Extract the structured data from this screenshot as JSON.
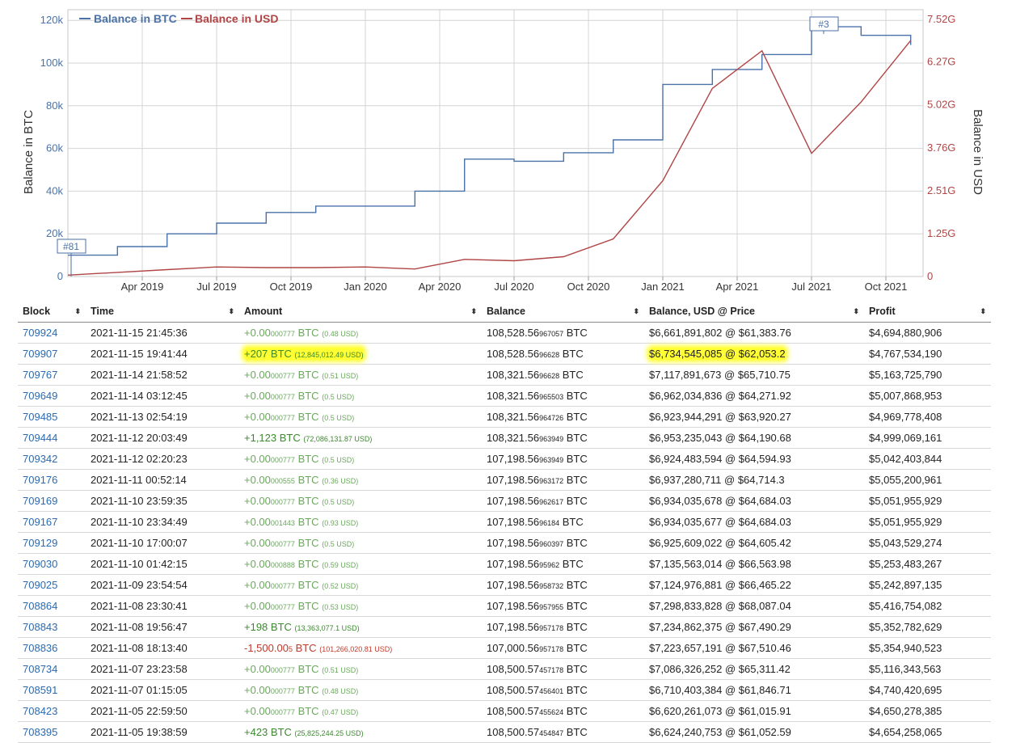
{
  "chart": {
    "legend": [
      {
        "label": "Balance in BTC",
        "color": "#4a72a8"
      },
      {
        "label": "Balance in USD",
        "color": "#b04545"
      }
    ],
    "y_left_label": "Balance in BTC",
    "y_right_label": "Balance in USD",
    "y_left_ticks": [
      "0",
      "20k",
      "40k",
      "60k",
      "80k",
      "100k",
      "120k"
    ],
    "y_right_ticks": [
      "0",
      "1.25G",
      "2.51G",
      "3.76G",
      "5.02G",
      "6.27G",
      "7.52G"
    ],
    "x_ticks": [
      "Apr 2019",
      "Jul 2019",
      "Oct 2019",
      "Jan 2020",
      "Apr 2020",
      "Jul 2020",
      "Oct 2020",
      "Jan 2021",
      "Apr 2021",
      "Jul 2021",
      "Oct 2021"
    ],
    "marker_start": "#81",
    "marker_peak": "#3"
  },
  "chart_data": {
    "type": "line",
    "x": [
      "2019-01",
      "2019-03",
      "2019-05",
      "2019-07",
      "2019-09",
      "2019-11",
      "2020-01",
      "2020-03",
      "2020-05",
      "2020-07",
      "2020-09",
      "2020-11",
      "2021-01",
      "2021-03",
      "2021-05",
      "2021-07",
      "2021-09",
      "2021-11"
    ],
    "series": [
      {
        "name": "Balance in BTC",
        "axis": "left",
        "color": "#4a72a8",
        "values": [
          10000,
          14000,
          20000,
          25000,
          30000,
          33000,
          33000,
          40000,
          55000,
          54000,
          58000,
          64000,
          90000,
          97000,
          104000,
          117000,
          113000,
          108500
        ]
      },
      {
        "name": "Balance in USD",
        "axis": "right",
        "color": "#b04545",
        "values": [
          40000000,
          120000000,
          200000000,
          280000000,
          260000000,
          260000000,
          280000000,
          220000000,
          500000000,
          460000000,
          580000000,
          1100000000,
          2800000000,
          5500000000,
          6600000000,
          3600000000,
          5100000000,
          6900000000
        ]
      }
    ],
    "ylim_left": [
      0,
      125000
    ],
    "ylim_right": [
      0,
      7800000000
    ],
    "legend_position": "top-left"
  },
  "table": {
    "headers": [
      "Block",
      "Time",
      "Amount",
      "Balance",
      "Balance, USD @ Price",
      "Profit"
    ],
    "rows": [
      {
        "block": "709924",
        "time": "2021-11-15 21:45:36",
        "amt_main": "+0.00",
        "amt_small": "000777",
        "amt_unit": " BTC",
        "amt_usd": "(0.48 USD)",
        "amt_type": "zero",
        "bal_main": "108,528.56",
        "bal_small": "967057",
        "bal_unit": " BTC",
        "usd": "$6,661,891,802 @ $61,383.76",
        "profit": "$4,694,880,906",
        "hl": false
      },
      {
        "block": "709907",
        "time": "2021-11-15 19:41:44",
        "amt_main": "+207",
        "amt_small": "",
        "amt_unit": " BTC",
        "amt_usd": "(12,845,012.49 USD)",
        "amt_type": "pos",
        "bal_main": "108,528.56",
        "bal_small": "96628",
        "bal_unit": " BTC",
        "usd": "$6,734,545,085 @ $62,053.2",
        "profit": "$4,767,534,190",
        "hl": true
      },
      {
        "block": "709767",
        "time": "2021-11-14 21:58:52",
        "amt_main": "+0.00",
        "amt_small": "000777",
        "amt_unit": " BTC",
        "amt_usd": "(0.51 USD)",
        "amt_type": "zero",
        "bal_main": "108,321.56",
        "bal_small": "96628",
        "bal_unit": " BTC",
        "usd": "$7,117,891,673 @ $65,710.75",
        "profit": "$5,163,725,790",
        "hl": false
      },
      {
        "block": "709649",
        "time": "2021-11-14 03:12:45",
        "amt_main": "+0.00",
        "amt_small": "000777",
        "amt_unit": " BTC",
        "amt_usd": "(0.5 USD)",
        "amt_type": "zero",
        "bal_main": "108,321.56",
        "bal_small": "965503",
        "bal_unit": " BTC",
        "usd": "$6,962,034,836 @ $64,271.92",
        "profit": "$5,007,868,953",
        "hl": false
      },
      {
        "block": "709485",
        "time": "2021-11-13 02:54:19",
        "amt_main": "+0.00",
        "amt_small": "000777",
        "amt_unit": " BTC",
        "amt_usd": "(0.5 USD)",
        "amt_type": "zero",
        "bal_main": "108,321.56",
        "bal_small": "964726",
        "bal_unit": " BTC",
        "usd": "$6,923,944,291 @ $63,920.27",
        "profit": "$4,969,778,408",
        "hl": false
      },
      {
        "block": "709444",
        "time": "2021-11-12 20:03:49",
        "amt_main": "+1,123",
        "amt_small": "",
        "amt_unit": " BTC",
        "amt_usd": "(72,086,131.87 USD)",
        "amt_type": "pos",
        "bal_main": "108,321.56",
        "bal_small": "963949",
        "bal_unit": " BTC",
        "usd": "$6,953,235,043 @ $64,190.68",
        "profit": "$4,999,069,161",
        "hl": false
      },
      {
        "block": "709342",
        "time": "2021-11-12 02:20:23",
        "amt_main": "+0.00",
        "amt_small": "000777",
        "amt_unit": " BTC",
        "amt_usd": "(0.5 USD)",
        "amt_type": "zero",
        "bal_main": "107,198.56",
        "bal_small": "963949",
        "bal_unit": " BTC",
        "usd": "$6,924,483,594 @ $64,594.93",
        "profit": "$5,042,403,844",
        "hl": false
      },
      {
        "block": "709176",
        "time": "2021-11-11 00:52:14",
        "amt_main": "+0.00",
        "amt_small": "000555",
        "amt_unit": " BTC",
        "amt_usd": "(0.36 USD)",
        "amt_type": "zero",
        "bal_main": "107,198.56",
        "bal_small": "963172",
        "bal_unit": " BTC",
        "usd": "$6,937,280,711 @ $64,714.3",
        "profit": "$5,055,200,961",
        "hl": false
      },
      {
        "block": "709169",
        "time": "2021-11-10 23:59:35",
        "amt_main": "+0.00",
        "amt_small": "000777",
        "amt_unit": " BTC",
        "amt_usd": "(0.5 USD)",
        "amt_type": "zero",
        "bal_main": "107,198.56",
        "bal_small": "962617",
        "bal_unit": " BTC",
        "usd": "$6,934,035,678 @ $64,684.03",
        "profit": "$5,051,955,929",
        "hl": false
      },
      {
        "block": "709167",
        "time": "2021-11-10 23:34:49",
        "amt_main": "+0.00",
        "amt_small": "001443",
        "amt_unit": " BTC",
        "amt_usd": "(0.93 USD)",
        "amt_type": "zero",
        "bal_main": "107,198.56",
        "bal_small": "96184",
        "bal_unit": " BTC",
        "usd": "$6,934,035,677 @ $64,684.03",
        "profit": "$5,051,955,929",
        "hl": false
      },
      {
        "block": "709129",
        "time": "2021-11-10 17:00:07",
        "amt_main": "+0.00",
        "amt_small": "000777",
        "amt_unit": " BTC",
        "amt_usd": "(0.5 USD)",
        "amt_type": "zero",
        "bal_main": "107,198.56",
        "bal_small": "960397",
        "bal_unit": " BTC",
        "usd": "$6,925,609,022 @ $64,605.42",
        "profit": "$5,043,529,274",
        "hl": false
      },
      {
        "block": "709030",
        "time": "2021-11-10 01:42:15",
        "amt_main": "+0.00",
        "amt_small": "000888",
        "amt_unit": " BTC",
        "amt_usd": "(0.59 USD)",
        "amt_type": "zero",
        "bal_main": "107,198.56",
        "bal_small": "95962",
        "bal_unit": " BTC",
        "usd": "$7,135,563,014 @ $66,563.98",
        "profit": "$5,253,483,267",
        "hl": false
      },
      {
        "block": "709025",
        "time": "2021-11-09 23:54:54",
        "amt_main": "+0.00",
        "amt_small": "000777",
        "amt_unit": " BTC",
        "amt_usd": "(0.52 USD)",
        "amt_type": "zero",
        "bal_main": "107,198.56",
        "bal_small": "958732",
        "bal_unit": " BTC",
        "usd": "$7,124,976,881 @ $66,465.22",
        "profit": "$5,242,897,135",
        "hl": false
      },
      {
        "block": "708864",
        "time": "2021-11-08 23:30:41",
        "amt_main": "+0.00",
        "amt_small": "000777",
        "amt_unit": " BTC",
        "amt_usd": "(0.53 USD)",
        "amt_type": "zero",
        "bal_main": "107,198.56",
        "bal_small": "957955",
        "bal_unit": " BTC",
        "usd": "$7,298,833,828 @ $68,087.04",
        "profit": "$5,416,754,082",
        "hl": false
      },
      {
        "block": "708843",
        "time": "2021-11-08 19:56:47",
        "amt_main": "+198",
        "amt_small": "",
        "amt_unit": " BTC",
        "amt_usd": "(13,363,077.1 USD)",
        "amt_type": "pos",
        "bal_main": "107,198.56",
        "bal_small": "957178",
        "bal_unit": " BTC",
        "usd": "$7,234,862,375 @ $67,490.29",
        "profit": "$5,352,782,629",
        "hl": false
      },
      {
        "block": "708836",
        "time": "2021-11-08 18:13:40",
        "amt_main": "-1,500.00",
        "amt_small": "5",
        "amt_unit": " BTC",
        "amt_usd": "(101,266,020.81 USD)",
        "amt_type": "neg",
        "bal_main": "107,000.56",
        "bal_small": "957178",
        "bal_unit": " BTC",
        "usd": "$7,223,657,191 @ $67,510.46",
        "profit": "$5,354,940,523",
        "hl": false
      },
      {
        "block": "708734",
        "time": "2021-11-07 23:23:58",
        "amt_main": "+0.00",
        "amt_small": "000777",
        "amt_unit": " BTC",
        "amt_usd": "(0.51 USD)",
        "amt_type": "zero",
        "bal_main": "108,500.57",
        "bal_small": "457178",
        "bal_unit": " BTC",
        "usd": "$7,086,326,252 @ $65,311.42",
        "profit": "$5,116,343,563",
        "hl": false
      },
      {
        "block": "708591",
        "time": "2021-11-07 01:15:05",
        "amt_main": "+0.00",
        "amt_small": "000777",
        "amt_unit": " BTC",
        "amt_usd": "(0.48 USD)",
        "amt_type": "zero",
        "bal_main": "108,500.57",
        "bal_small": "456401",
        "bal_unit": " BTC",
        "usd": "$6,710,403,384 @ $61,846.71",
        "profit": "$4,740,420,695",
        "hl": false
      },
      {
        "block": "708423",
        "time": "2021-11-05 22:59:50",
        "amt_main": "+0.00",
        "amt_small": "000777",
        "amt_unit": " BTC",
        "amt_usd": "(0.47 USD)",
        "amt_type": "zero",
        "bal_main": "108,500.57",
        "bal_small": "455624",
        "bal_unit": " BTC",
        "usd": "$6,620,261,073 @ $61,015.91",
        "profit": "$4,650,278,385",
        "hl": false
      },
      {
        "block": "708395",
        "time": "2021-11-05 19:38:59",
        "amt_main": "+423",
        "amt_small": "",
        "amt_unit": " BTC",
        "amt_usd": "(25,825,244.25 USD)",
        "amt_type": "pos",
        "bal_main": "108,500.57",
        "bal_small": "454847",
        "bal_unit": " BTC",
        "usd": "$6,624,240,753 @ $61,052.59",
        "profit": "$4,654,258,065",
        "hl": false
      }
    ]
  }
}
